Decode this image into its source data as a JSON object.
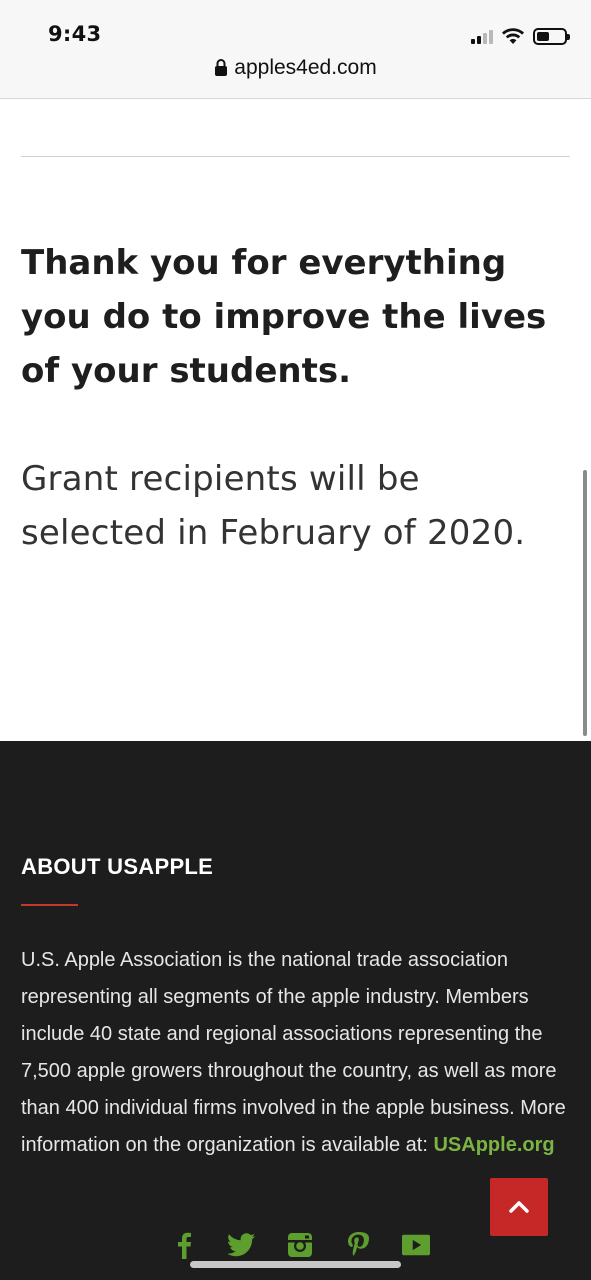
{
  "status_bar": {
    "time": "9:43",
    "url": "apples4ed.com"
  },
  "content": {
    "thanks": "Thank you for everything you do to improve the lives of your students.",
    "grant": "Grant recipients will be selected in February of 2020."
  },
  "footer": {
    "about_title": "ABOUT USAPPLE",
    "about_text": "U.S. Apple Association is the national trade association representing all segments of the apple industry. Members include 40 state and regional associations representing the 7,500 apple growers throughout the country, as well as more than 400 individual firms involved in the apple business. More information on the organization is available at:",
    "about_link": "USApple.org",
    "social_icons": [
      "facebook-icon",
      "twitter-icon",
      "instagram-icon",
      "pinterest-icon",
      "youtube-icon"
    ]
  },
  "colors": {
    "footer_bg": "#1d1d1d",
    "accent_red": "#c62828",
    "link_green": "#7cb342"
  }
}
